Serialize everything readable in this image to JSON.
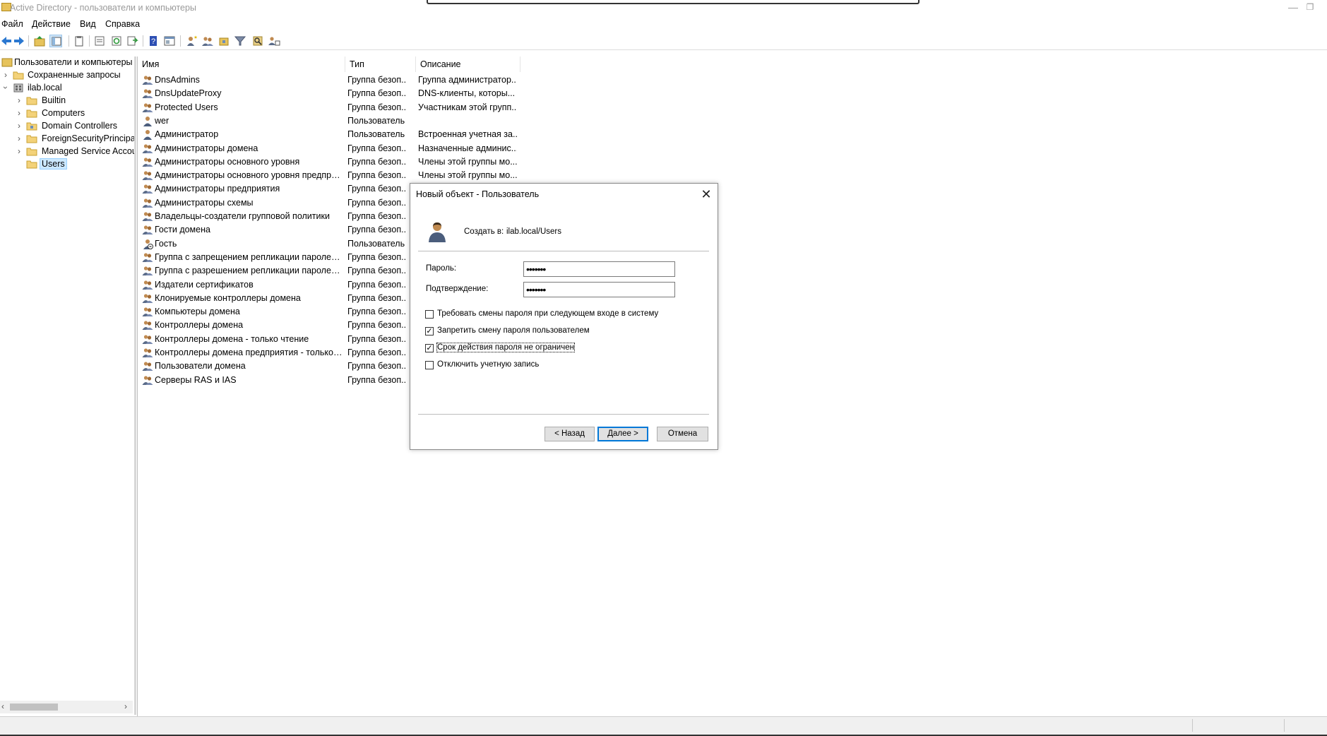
{
  "window": {
    "title": "Active Directory - пользователи и компьютеры",
    "minimize_glyph": "—",
    "restore_glyph": "❐"
  },
  "menu": [
    "Файл",
    "Действие",
    "Вид",
    "Справка"
  ],
  "toolbar": {
    "icons": [
      "back-icon",
      "forward-icon",
      "up-folder-icon",
      "show-tree-icon",
      "clipboard-icon",
      "properties-icon",
      "refresh-icon",
      "export-icon",
      "help-icon",
      "console-icon",
      "new-user-icon",
      "new-group-icon",
      "new-ou-icon",
      "filter-icon",
      "find-icon",
      "add-to-group-icon"
    ]
  },
  "tree": {
    "root": "Пользователи и компьютеры Active Directory",
    "saved_queries": "Сохраненные запросы",
    "domain": "ilab.local",
    "children": [
      "Builtin",
      "Computers",
      "Domain Controllers",
      "ForeignSecurityPrincipals",
      "Managed Service Accounts",
      "Users"
    ],
    "selected": "Users"
  },
  "list": {
    "columns": [
      "Имя",
      "Тип",
      "Описание"
    ],
    "rows": [
      {
        "name": "DnsAdmins",
        "type": "Группа безоп...",
        "desc": "Группа администратор...",
        "kind": "group"
      },
      {
        "name": "DnsUpdateProxy",
        "type": "Группа безоп...",
        "desc": "DNS-клиенты, которы...",
        "kind": "group"
      },
      {
        "name": "Protected Users",
        "type": "Группа безоп...",
        "desc": "Участникам этой групп...",
        "kind": "group"
      },
      {
        "name": "wer",
        "type": "Пользователь",
        "desc": "",
        "kind": "user"
      },
      {
        "name": "Администратор",
        "type": "Пользователь",
        "desc": "Встроенная учетная за...",
        "kind": "user"
      },
      {
        "name": "Администраторы домена",
        "type": "Группа безоп...",
        "desc": "Назначенные админис...",
        "kind": "group"
      },
      {
        "name": "Администраторы основного уровня",
        "type": "Группа безоп...",
        "desc": "Члены этой группы мо...",
        "kind": "group"
      },
      {
        "name": "Администраторы основного уровня предприя...",
        "type": "Группа безоп...",
        "desc": "Члены этой группы мо...",
        "kind": "group"
      },
      {
        "name": "Администраторы предприятия",
        "type": "Группа безоп...",
        "desc": "",
        "kind": "group"
      },
      {
        "name": "Администраторы схемы",
        "type": "Группа безоп...",
        "desc": "",
        "kind": "group"
      },
      {
        "name": "Владельцы-создатели групповой политики",
        "type": "Группа безоп...",
        "desc": "",
        "kind": "group"
      },
      {
        "name": "Гости домена",
        "type": "Группа безоп...",
        "desc": "",
        "kind": "group"
      },
      {
        "name": "Гость",
        "type": "Пользователь",
        "desc": "",
        "kind": "user-disabled"
      },
      {
        "name": "Группа с запрещением репликации паролей R...",
        "type": "Группа безоп...",
        "desc": "",
        "kind": "group"
      },
      {
        "name": "Группа с разрешением репликации паролей R...",
        "type": "Группа безоп...",
        "desc": "",
        "kind": "group"
      },
      {
        "name": "Издатели сертификатов",
        "type": "Группа безоп...",
        "desc": "",
        "kind": "group"
      },
      {
        "name": "Клонируемые контроллеры домена",
        "type": "Группа безоп...",
        "desc": "",
        "kind": "group"
      },
      {
        "name": "Компьютеры домена",
        "type": "Группа безоп...",
        "desc": "",
        "kind": "group"
      },
      {
        "name": "Контроллеры домена",
        "type": "Группа безоп...",
        "desc": "",
        "kind": "group"
      },
      {
        "name": "Контроллеры домена - только чтение",
        "type": "Группа безоп...",
        "desc": "",
        "kind": "group"
      },
      {
        "name": "Контроллеры домена предприятия - только чт...",
        "type": "Группа безоп...",
        "desc": "",
        "kind": "group"
      },
      {
        "name": "Пользователи домена",
        "type": "Группа безоп...",
        "desc": "",
        "kind": "group"
      },
      {
        "name": "Серверы RAS и IAS",
        "type": "Группа безоп...",
        "desc": "",
        "kind": "group"
      }
    ]
  },
  "dialog": {
    "title": "Новый объект - Пользователь",
    "create_in_label": "Создать в:",
    "create_in_value": "ilab.local/Users",
    "password_label": "Пароль:",
    "password_value": "•••••••",
    "confirm_label": "Подтверждение:",
    "confirm_value": "•••••••",
    "checkboxes": [
      {
        "label": "Требовать смены пароля при следующем входе в систему",
        "checked": false
      },
      {
        "label": "Запретить смену пароля пользователем",
        "checked": true
      },
      {
        "label": "Срок действия пароля не ограничен",
        "checked": true
      },
      {
        "label": "Отключить учетную запись",
        "checked": false
      }
    ],
    "back_button": "< Назад",
    "next_button": "Далее >",
    "cancel_button": "Отмена"
  }
}
